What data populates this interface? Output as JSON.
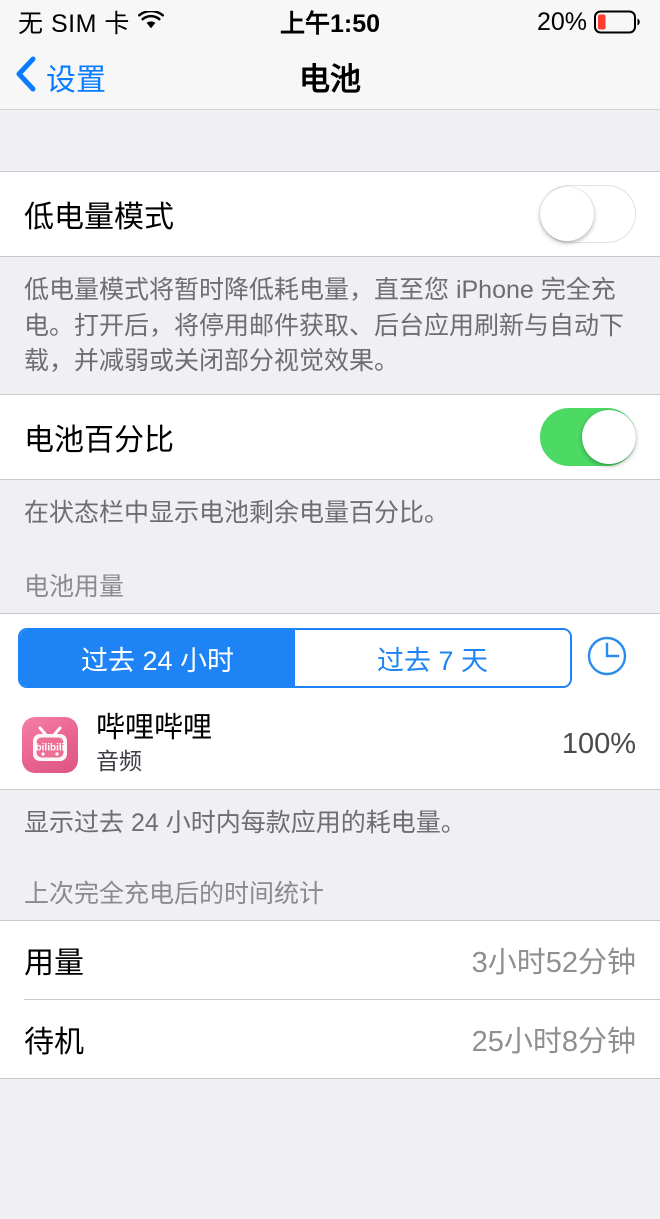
{
  "status_bar": {
    "carrier": "无 SIM 卡",
    "wifi_icon": "wifi-icon",
    "time": "上午1:50",
    "battery_percent_label": "20%",
    "battery_level": 20,
    "battery_color": "#FF3B30"
  },
  "nav": {
    "back_label": "设置",
    "back_icon": "chevron-left-icon",
    "title": "电池",
    "tint_color": "#0A7CFF"
  },
  "low_power": {
    "title": "低电量模式",
    "enabled": false,
    "footer": "低电量模式将暂时降低耗电量，直至您 iPhone 完全充电。打开后，将停用邮件获取、后台应用刷新与自动下载，并减弱或关闭部分视觉效果。"
  },
  "battery_percentage": {
    "title": "电池百分比",
    "enabled": true,
    "footer": "在状态栏中显示电池剩余电量百分比。",
    "on_color": "#4CD964"
  },
  "battery_usage": {
    "section_header": "电池用量",
    "segments": [
      {
        "label": "过去 24 小时",
        "selected": true
      },
      {
        "label": "过去 7 天",
        "selected": false
      }
    ],
    "clock_icon": "clock-icon",
    "accent_color": "#1E84F5",
    "apps": [
      {
        "name": "哔哩哔哩",
        "subtitle": "音频",
        "percent": "100%",
        "icon": "bilibili-app-icon"
      }
    ],
    "footer": "显示过去 24 小时内每款应用的耗电量。"
  },
  "time_since_charge": {
    "section_header": "上次完全充电后的时间统计",
    "rows": [
      {
        "label": "用量",
        "value": "3小时52分钟"
      },
      {
        "label": "待机",
        "value": "25小时8分钟"
      }
    ]
  }
}
